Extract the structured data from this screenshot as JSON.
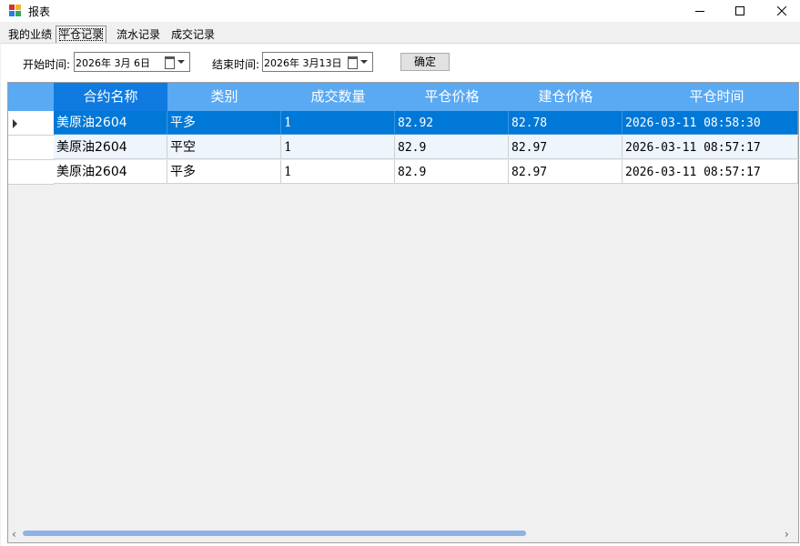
{
  "window": {
    "title": "报表"
  },
  "tabs": [
    {
      "label": "我的业绩"
    },
    {
      "label": "平仓记录"
    },
    {
      "label": "流水记录"
    },
    {
      "label": "成交记录"
    }
  ],
  "filter": {
    "start_label": "开始时间:",
    "start_value": "2026年  3月  6日",
    "end_label": "结束时间:",
    "end_value": "2026年  3月13日",
    "confirm_label": "确定"
  },
  "grid": {
    "columns": [
      "合约名称",
      "类别",
      "成交数量",
      "平仓价格",
      "建仓价格",
      "平仓时间"
    ],
    "rows": [
      [
        "美原油2604",
        "平多",
        "1",
        "82.92",
        "82.78",
        "2026-03-11 08:58:30"
      ],
      [
        "美原油2604",
        "平空",
        "1",
        "82.9",
        "82.97",
        "2026-03-11 08:57:17"
      ],
      [
        "美原油2604",
        "平多",
        "1",
        "82.9",
        "82.97",
        "2026-03-11 08:57:17"
      ]
    ]
  },
  "colors": {
    "header_bg": "#5aa9f3",
    "header_selected_bg": "#0f7ae0",
    "selected_row_bg": "#0078d7",
    "alt_row_bg": "#eef5fd"
  },
  "icons": [
    "app-icon",
    "minimize-icon",
    "maximize-icon",
    "close-icon",
    "calendar-icon",
    "dropdown-arrow-icon",
    "row-selector-icon",
    "scroll-left-icon",
    "scroll-right-icon"
  ]
}
